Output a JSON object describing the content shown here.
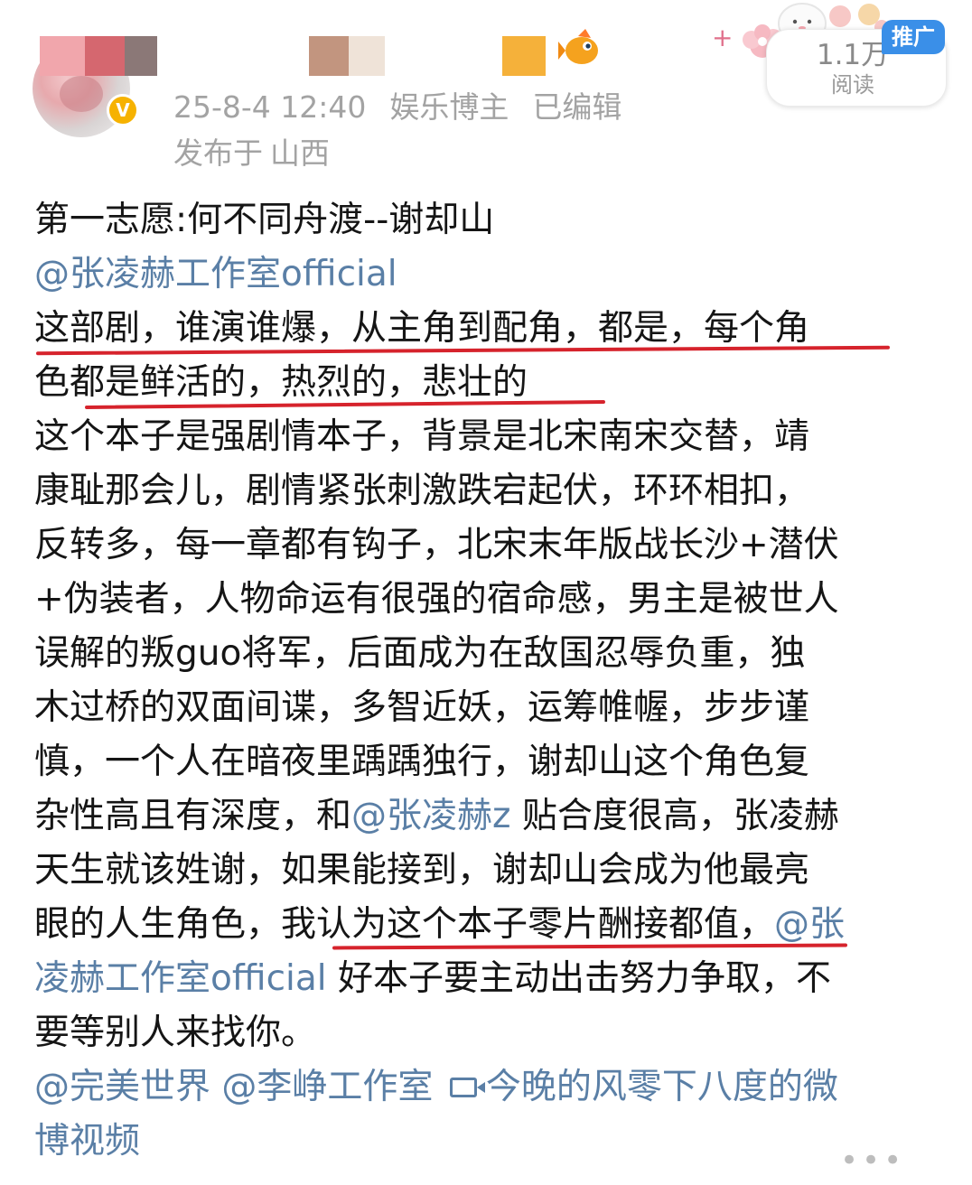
{
  "post": {
    "header": {
      "timestamp": "25-8-4 12:40",
      "category": "娱乐博主",
      "edited": "已编辑",
      "location_prefix": "发布于",
      "location": "山西",
      "reads": {
        "count": "1.1万",
        "label": "阅读"
      },
      "promo_badge": "推广"
    },
    "body": {
      "line1": "第一志愿:何不同舟渡--谢却山",
      "line2_mention": "@张凌赫工作室official",
      "line3": "这部剧，谁演谁爆，从主角到配角，都是，每个角",
      "line4": "色都是鲜活的，热烈的，悲壮的",
      "line5": "这个本子是强剧情本子，背景是北宋南宋交替，靖",
      "line6": "康耻那会儿，剧情紧张刺激跌宕起伏，环环相扣，",
      "line7": "反转多，每一章都有钩子，北宋末年版战长沙+潜伏",
      "line8": "+伪装者，人物命运有很强的宿命感，男主是被世人",
      "line9": "误解的叛guo将军，后面成为在敌国忍辱负重，独",
      "line10": "木过桥的双面间谍，多智近妖，运筹帷幄，步步谨",
      "line11": "慎，一个人在暗夜里踽踽独行，谢却山这个角色复",
      "line12_pre": "杂性高且有深度，和",
      "line12_mention": "@张凌赫z",
      "line12_post": " 贴合度很高，张凌赫",
      "line13": "天生就该姓谢，如果能接到，谢却山会成为他最亮",
      "line14_pre": "眼的人生角色，我认为这个本子零片酬接都值，",
      "line14_mention": "@张",
      "line15_mention": "凌赫工作室official",
      "line15_post": " 好本子要主动出击努力争取，不",
      "line16": "要等别人来找你。",
      "line17_mention1": "@完美世界",
      "line17_mention2": "@李峥工作室",
      "line17_video": "今晚的风零下八度的微",
      "line18_video": "博视频"
    },
    "more_dots": "•••",
    "colors": {
      "mention": "#5a7fa6",
      "underline": "#d6232c",
      "meta_text": "#a3a3a3",
      "promo_badge": "#3a8fe8",
      "verify_badge": "#f6b200"
    },
    "icons": [
      "avatar",
      "verified-badge-icon",
      "sticker-decoration-icon",
      "video-icon"
    ]
  }
}
